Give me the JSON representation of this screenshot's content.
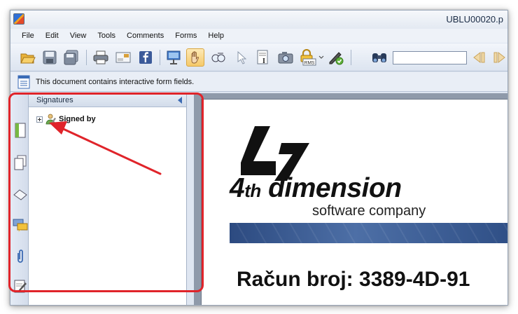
{
  "window": {
    "title": "UBLU00020.p"
  },
  "menu": {
    "items": [
      "File",
      "Edit",
      "View",
      "Tools",
      "Comments",
      "Forms",
      "Help"
    ]
  },
  "toolbar": {
    "buttons": [
      {
        "name": "open-icon"
      },
      {
        "name": "save-icon"
      },
      {
        "name": "save-all-icon"
      },
      {
        "name": "print-icon"
      },
      {
        "name": "email-icon"
      },
      {
        "name": "facebook-icon"
      },
      {
        "name": "presentation-icon"
      },
      {
        "name": "hand-tool-icon",
        "active": true
      },
      {
        "name": "snapshot-zoom-icon"
      },
      {
        "name": "select-pointer-icon"
      },
      {
        "name": "select-text-icon"
      },
      {
        "name": "camera-icon"
      },
      {
        "name": "lock-rms-icon"
      },
      {
        "name": "sign-pen-icon"
      },
      {
        "name": "binoculars-icon"
      },
      {
        "name": "prev-result-icon"
      },
      {
        "name": "next-result-icon"
      }
    ],
    "search_value": "",
    "rms_label": "RMS"
  },
  "infobar": {
    "message": "This document contains interactive form fields."
  },
  "sidebar": {
    "rail": [
      "bookmarks-icon",
      "pages-icon",
      "layers-icon",
      "comments-icon",
      "attachments-icon",
      "signatures-icon"
    ],
    "panel_title": "Signatures",
    "tree": [
      {
        "label": "Signed by"
      }
    ]
  },
  "document": {
    "logo_numeral": "47",
    "brand_prefix": "4",
    "brand_suffix": "th",
    "brand_word": "dimension",
    "tagline": "software company",
    "invoice_title": "Račun broj: 3389-4D-91"
  },
  "colors": {
    "annotation_red": "#e0242a",
    "banner_blue": "#3a5a93",
    "active_tool": "#f5c96a"
  }
}
